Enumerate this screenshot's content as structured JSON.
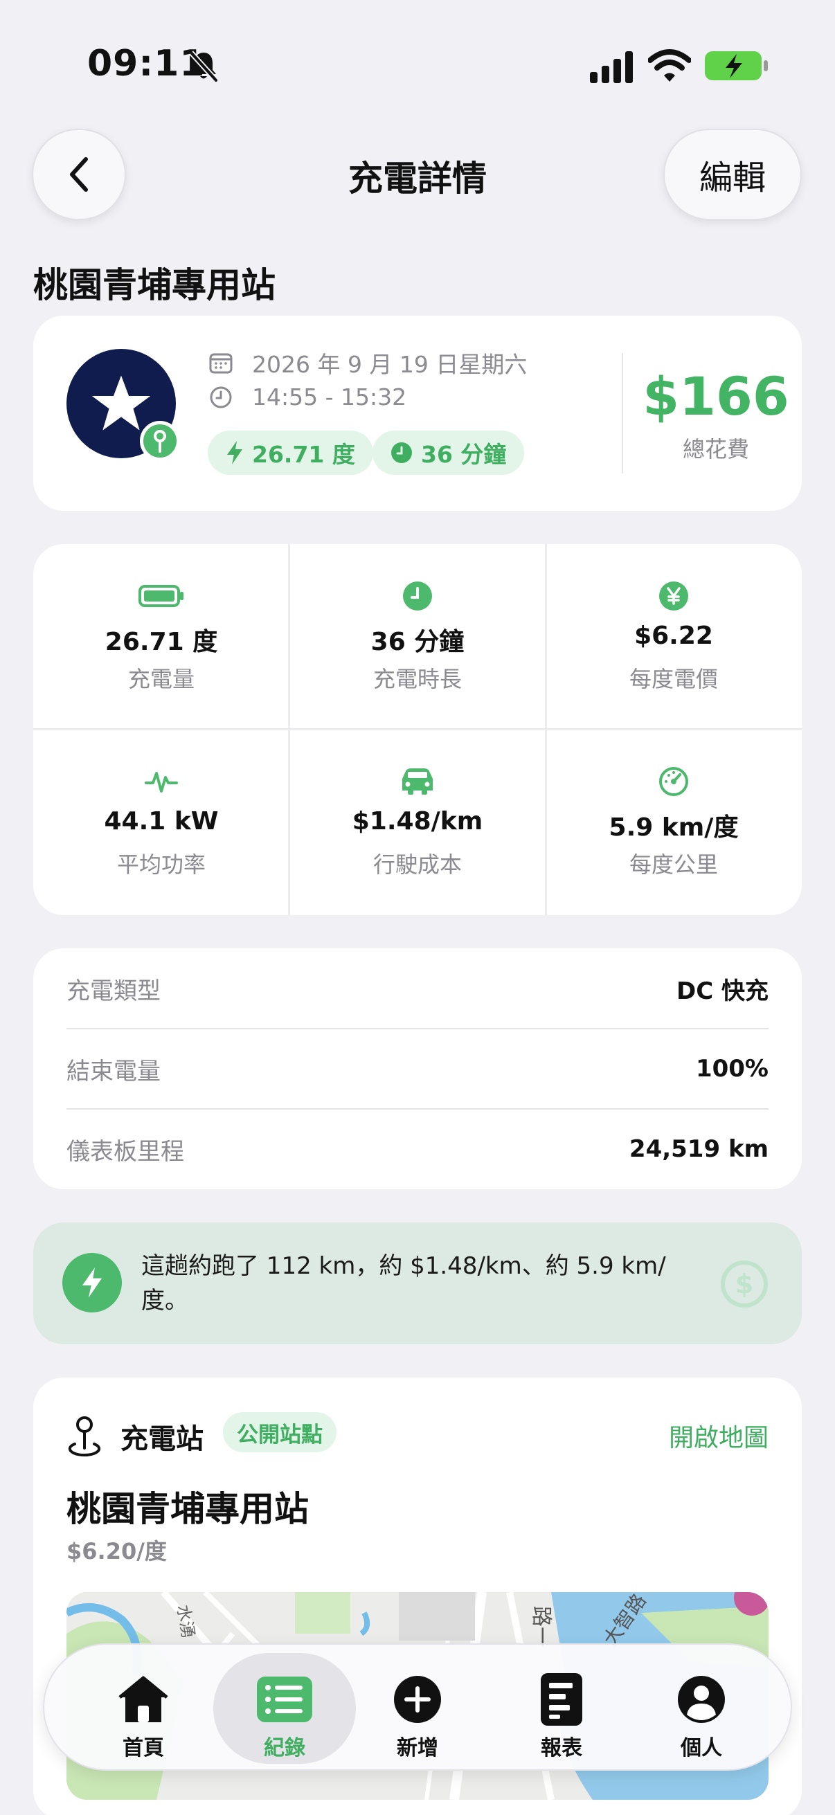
{
  "status_bar": {
    "time": "09:11"
  },
  "nav": {
    "title": "充電詳情",
    "edit_label": "編輯"
  },
  "station_heading": "桃園青埔專用站",
  "summary": {
    "date": "2026 年 9 月 19 日星期六",
    "time_range": "14:55 - 15:32",
    "energy_pill": "26.71 度",
    "duration_pill": "36 分鐘",
    "total_cost": "$166",
    "total_label": "總花費"
  },
  "stats": [
    {
      "icon": "battery-icon",
      "value": "26.71 度",
      "label": "充電量"
    },
    {
      "icon": "clock-icon",
      "value": "36 分鐘",
      "label": "充電時長"
    },
    {
      "icon": "yen-icon",
      "value": "$6.22",
      "label": "每度電價"
    },
    {
      "icon": "pulse-icon",
      "value": "44.1 kW",
      "label": "平均功率"
    },
    {
      "icon": "car-icon",
      "value": "$1.48/km",
      "label": "行駛成本"
    },
    {
      "icon": "gauge-icon",
      "value": "5.9 km/度",
      "label": "每度公里"
    }
  ],
  "details": [
    {
      "label": "充電類型",
      "value": "DC 快充"
    },
    {
      "label": "結束電量",
      "value": "100%"
    },
    {
      "label": "儀表板里程",
      "value": "24,519 km"
    }
  ],
  "tip": {
    "text": "這趟約跑了 112 km，約 $1.48/km、約 5.9 km/度。"
  },
  "station_card": {
    "section_label": "充電站",
    "badge": "公開站點",
    "open_map": "開啟地圖",
    "name": "桃園青埔專用站",
    "price": "$6.20/度",
    "map_labels": [
      "水湧",
      "路一",
      "大智路"
    ]
  },
  "tabs": [
    {
      "label": "首頁",
      "icon": "home-icon",
      "active": false
    },
    {
      "label": "紀錄",
      "icon": "list-icon",
      "active": true
    },
    {
      "label": "新增",
      "icon": "plus-circle-icon",
      "active": false
    },
    {
      "label": "報表",
      "icon": "report-icon",
      "active": false
    },
    {
      "label": "個人",
      "icon": "person-icon",
      "active": false
    }
  ],
  "colors": {
    "accent": "#4cb96c",
    "navy": "#0f1c4d",
    "tip_bg": "#dde9e3"
  }
}
